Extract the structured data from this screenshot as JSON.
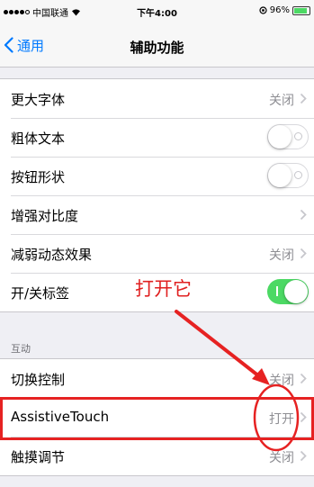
{
  "status_bar": {
    "carrier": "中国联通",
    "time": "下午4:00",
    "battery": "96%",
    "battery_level": 0.96
  },
  "nav": {
    "back_label": "通用",
    "title": "辅助功能"
  },
  "group1": {
    "rows": [
      {
        "label": "更大字体",
        "value": "关闭"
      },
      {
        "label": "粗体文本",
        "toggle": "off"
      },
      {
        "label": "按钮形状",
        "toggle": "off"
      },
      {
        "label": "增强对比度"
      },
      {
        "label": "减弱动态效果",
        "value": "关闭"
      },
      {
        "label": "开/关标签",
        "toggle": "on"
      }
    ]
  },
  "section_header": "互动",
  "group2": {
    "rows": [
      {
        "label": "切换控制",
        "value": "关闭"
      },
      {
        "label": "AssistiveTouch",
        "value": "打开"
      },
      {
        "label": "触摸调节",
        "value": "关闭"
      }
    ]
  },
  "annotation": {
    "text": "打开它",
    "color": "#e02020"
  },
  "colors": {
    "accent": "#007aff",
    "toggle_on": "#4cd964",
    "highlight": "#e62222"
  }
}
